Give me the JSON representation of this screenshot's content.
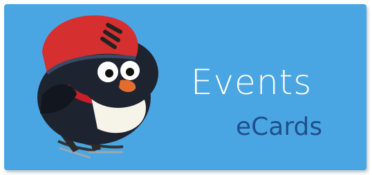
{
  "banner": {
    "title": "Events",
    "subtitle": "eCards",
    "background_color": "#4aa6e2",
    "title_color": "#ffffff",
    "subtitle_color": "#1f4f8c",
    "mascot_icon": "penguin-hockey-helmet-skates-icon"
  }
}
